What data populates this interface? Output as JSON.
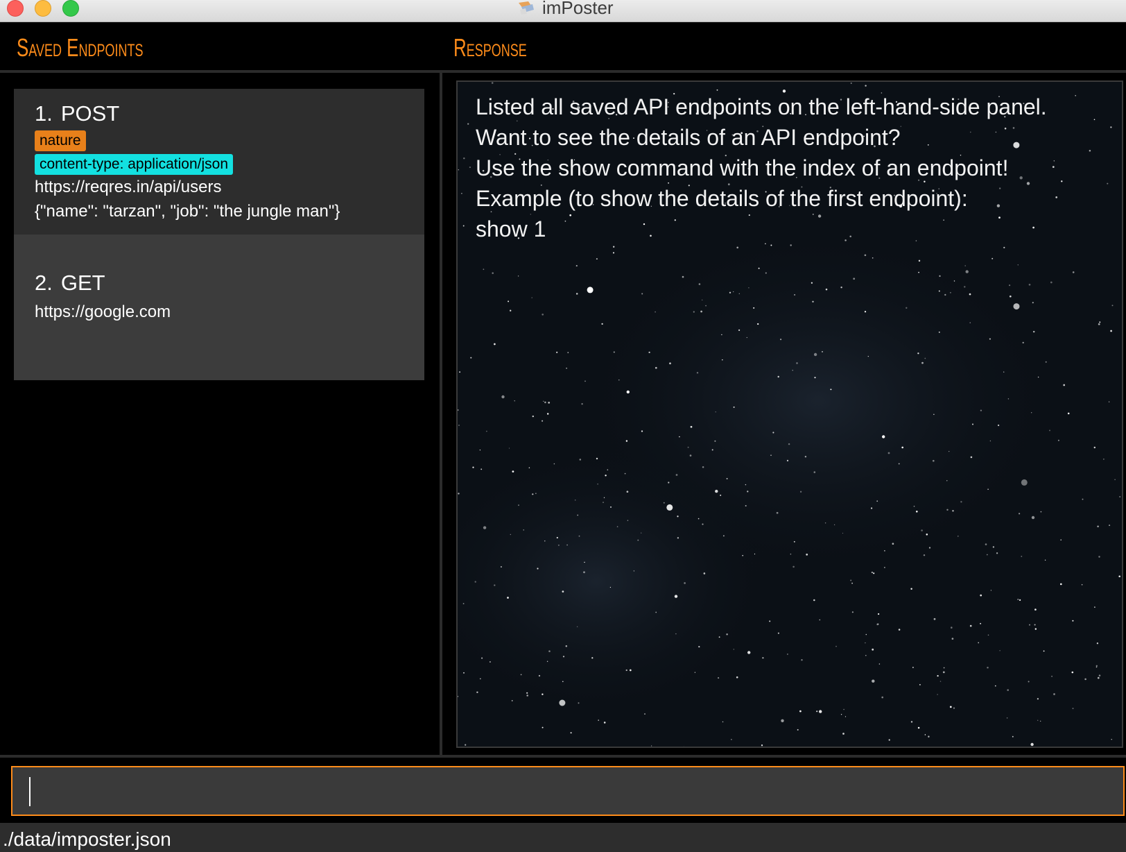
{
  "window": {
    "title": "imPoster"
  },
  "headers": {
    "left": "Saved Endpoints",
    "right": "Response"
  },
  "endpoints": [
    {
      "index": "1.",
      "method": "POST",
      "tags": [
        "nature",
        "content-type: application/json"
      ],
      "url": "https://reqres.in/api/users",
      "body": "{\"name\": \"tarzan\", \"job\": \"the jungle man\"}"
    },
    {
      "index": "2.",
      "method": "GET",
      "url": "https://google.com"
    }
  ],
  "response": {
    "lines": [
      "Listed all saved API endpoints on the left-hand-side panel.",
      "Want to see the details of an API endpoint?",
      "Use the show command with the index of an endpoint!",
      "Example (to show the details of the first endpoint):",
      "show 1"
    ]
  },
  "command": {
    "value": "",
    "placeholder": ""
  },
  "status": {
    "path": "./data/imposter.json"
  },
  "colors": {
    "accent": "#ff8c1a",
    "tag_orange": "#e8801a",
    "tag_cyan": "#13e0e0"
  }
}
